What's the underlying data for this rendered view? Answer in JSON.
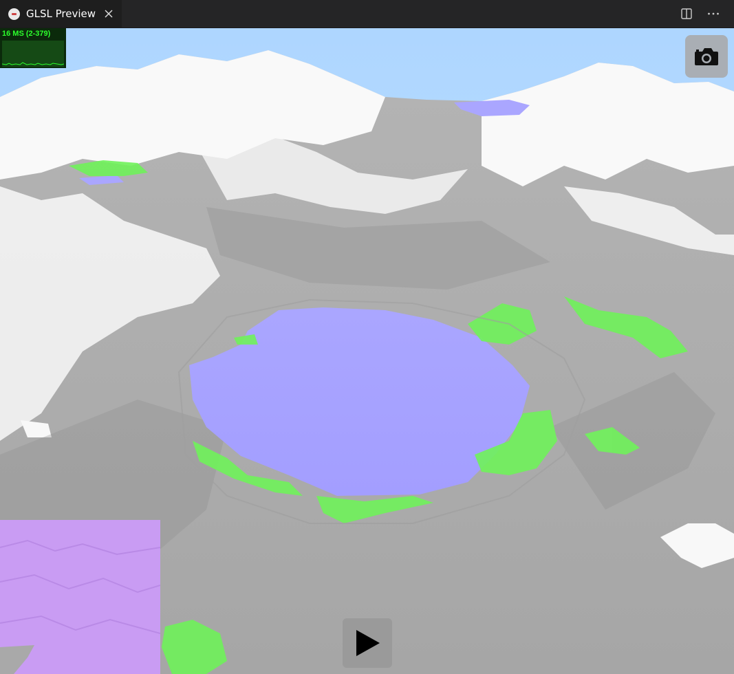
{
  "tab": {
    "title": "GLSL Preview",
    "icon": "glsl-file-icon"
  },
  "toolbar": {
    "split_icon": "split-editor-icon",
    "more_icon": "more-actions-icon"
  },
  "stats": {
    "label": "16 MS (2-379)",
    "color": "#2cff2c"
  },
  "controls": {
    "camera_icon": "camera-icon",
    "play_icon": "play-icon"
  },
  "scene": {
    "sky_color": "#b7dcff",
    "rock_color": "#a9a9a9",
    "snow_color": "#ffffff",
    "water_color": "#a6a1ff",
    "grass_color": "#6ff25a",
    "minimap_color": "#c99cf3"
  }
}
